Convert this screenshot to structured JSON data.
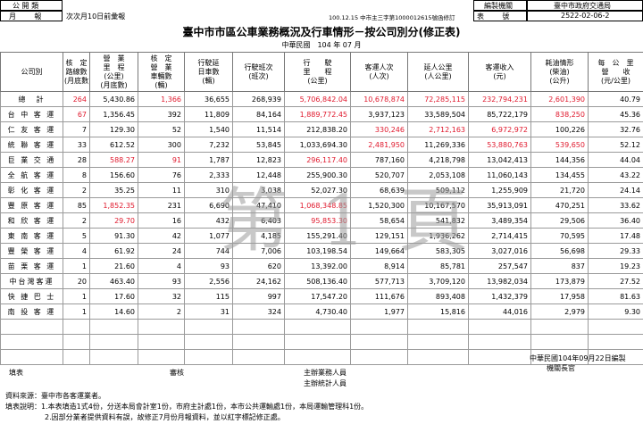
{
  "header": {
    "left_label_1": "公 開 類",
    "left_label_2": "月        報",
    "release_note": "次次月10日前彙報",
    "approval_note": "100.12.15 中市主三字第1000012615號函修訂",
    "agency_label": "編製機關",
    "agency_value": "臺中市政府交通局",
    "form_no_label": "表        號",
    "form_no_value": "2522-02-06-2",
    "title": "臺中市市區公車業務概況及行車情形－按公司別分(修正表)",
    "period": "中華民國　104 年 07 月"
  },
  "columns": [
    {
      "line1": "公司別",
      "line2": "",
      "line3": "",
      "unit": ""
    },
    {
      "line1": "核　定",
      "line2": "路線數",
      "line3": "",
      "unit": "(月底數)"
    },
    {
      "line1": "營　業",
      "line2": "里　程",
      "line3": "(公里)",
      "unit": "(月底數)"
    },
    {
      "line1": "核　定",
      "line2": "營　業",
      "line3": "車輛數",
      "unit": "(輛)"
    },
    {
      "line1": "行駛延",
      "line2": "日車數",
      "line3": "",
      "unit": "(輛)"
    },
    {
      "line1": "行駛班次",
      "line2": "",
      "line3": "",
      "unit": "(班次)"
    },
    {
      "line1": "行　　駛",
      "line2": "里　　程",
      "line3": "",
      "unit": "(公里)"
    },
    {
      "line1": "客運人次",
      "line2": "",
      "line3": "",
      "unit": "(人次)"
    },
    {
      "line1": "延人公里",
      "line2": "",
      "line3": "",
      "unit": "(人公里)"
    },
    {
      "line1": "客運收入",
      "line2": "",
      "line3": "",
      "unit": "(元)"
    },
    {
      "line1": "耗油情形",
      "line2": "(柴油)",
      "line3": "",
      "unit": "(公升)"
    },
    {
      "line1": "每　公　里",
      "line2": "營　　收",
      "line3": "",
      "unit": "(元/公里)"
    }
  ],
  "rows": [
    {
      "name": "總　計",
      "cells": [
        "264",
        "5,430.86",
        "1,366",
        "36,655",
        "268,939",
        "5,706,842.04",
        "10,678,874",
        "72,285,115",
        "232,794,231",
        "2,601,390",
        "40.79"
      ],
      "red": [
        0,
        2,
        5,
        6,
        7,
        8,
        9
      ]
    },
    {
      "name": "台 中 客 運",
      "cells": [
        "67",
        "1,356.45",
        "392",
        "11,809",
        "84,164",
        "1,889,772.45",
        "3,937,123",
        "33,589,504",
        "85,722,179",
        "838,250",
        "45.36"
      ],
      "red": [
        0,
        5,
        9
      ]
    },
    {
      "name": "仁 友 客 運",
      "cells": [
        "7",
        "129.30",
        "52",
        "1,540",
        "11,514",
        "212,838.20",
        "330,246",
        "2,712,163",
        "6,972,972",
        "100,226",
        "32.76"
      ],
      "red": [
        6,
        7,
        8
      ]
    },
    {
      "name": "統 聯 客 運",
      "cells": [
        "33",
        "612.52",
        "300",
        "7,232",
        "53,845",
        "1,033,694.30",
        "2,481,950",
        "11,269,336",
        "53,880,763",
        "539,650",
        "52.12"
      ],
      "red": [
        6,
        8,
        9
      ]
    },
    {
      "name": "巨 業 交 通",
      "cells": [
        "28",
        "588.27",
        "91",
        "1,787",
        "12,823",
        "296,117.40",
        "787,160",
        "4,218,798",
        "13,042,413",
        "144,356",
        "44.04"
      ],
      "red": [
        1,
        2,
        5
      ]
    },
    {
      "name": "全 航 客 運",
      "cells": [
        "8",
        "156.60",
        "76",
        "2,333",
        "12,448",
        "255,900.30",
        "520,707",
        "2,053,108",
        "11,060,143",
        "134,455",
        "43.22"
      ],
      "red": []
    },
    {
      "name": "彰 化 客 運",
      "cells": [
        "2",
        "35.25",
        "11",
        "310",
        "3,038",
        "52,027.30",
        "68,639",
        "509,112",
        "1,255,909",
        "21,720",
        "24.14"
      ],
      "red": []
    },
    {
      "name": "豐 原 客 運",
      "cells": [
        "85",
        "1,852.35",
        "231",
        "6,690",
        "47,410",
        "1,068,348.85",
        "1,520,300",
        "10,167,570",
        "35,913,091",
        "470,251",
        "33.62"
      ],
      "red": [
        1,
        5
      ]
    },
    {
      "name": "和 欣 客 運",
      "cells": [
        "2",
        "29.70",
        "16",
        "432",
        "6,403",
        "95,853.30",
        "58,654",
        "541,832",
        "3,489,354",
        "29,506",
        "36.40"
      ],
      "red": [
        1,
        5
      ]
    },
    {
      "name": "東 南 客 運",
      "cells": [
        "5",
        "91.30",
        "42",
        "1,077",
        "4,185",
        "155,291.40",
        "129,151",
        "1,936,262",
        "2,714,415",
        "70,595",
        "17.48"
      ],
      "red": []
    },
    {
      "name": "豐 榮 客 運",
      "cells": [
        "4",
        "61.92",
        "24",
        "744",
        "7,006",
        "103,198.54",
        "149,664",
        "583,305",
        "3,027,016",
        "56,698",
        "29.33"
      ],
      "red": []
    },
    {
      "name": "苗 栗 客 運",
      "cells": [
        "1",
        "21.60",
        "4",
        "93",
        "620",
        "13,392.00",
        "8,914",
        "85,781",
        "257,547",
        "837",
        "19.23"
      ],
      "red": []
    },
    {
      "name": "中台灣客運",
      "cells": [
        "20",
        "463.40",
        "93",
        "2,556",
        "24,162",
        "508,136.40",
        "577,713",
        "3,709,120",
        "13,982,034",
        "173,879",
        "27.52"
      ],
      "red": []
    },
    {
      "name": "快 捷 巴 士",
      "cells": [
        "1",
        "17.60",
        "32",
        "115",
        "997",
        "17,547.20",
        "111,676",
        "893,408",
        "1,432,379",
        "17,958",
        "81.63"
      ],
      "red": []
    },
    {
      "name": "南 投 客 運",
      "cells": [
        "1",
        "14.60",
        "2",
        "31",
        "324",
        "4,730.40",
        "1,977",
        "15,816",
        "44,016",
        "2,979",
        "9.30"
      ],
      "red": []
    }
  ],
  "watermark": "第 1 頁",
  "footer": {
    "date_line": "中華民國104年09月22日編製",
    "chief_label": "機關長官",
    "filler_label": "填表",
    "reviewer_label": "審核",
    "business_label": "主辦業務人員",
    "stats_label": "主辦統計人員",
    "source": "資料來源：臺中市各客運業者。",
    "note1": "填表說明：1.本表填造1式4份，分送本局會計室1份，市府主計處1份，本市公共運輸處1份，本局運輸管理科1份。",
    "note2": "2.因部分業者提供資料有誤，故修正7月份月報資料，並以紅字標記修正處。"
  },
  "colors": {
    "red": "#e0192d",
    "watermark": "#9c9c9c"
  }
}
